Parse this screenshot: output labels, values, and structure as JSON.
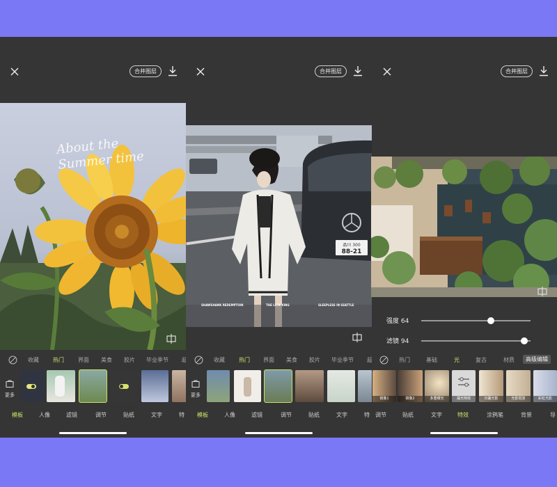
{
  "colors": {
    "accent": "#c9e36a",
    "background": "#7b78f6",
    "app_bg": "#353535"
  },
  "toolbar": {
    "merge_label": "合并图层"
  },
  "panels": [
    {
      "photo_caption": "About the Summer time",
      "categories": [
        "收藏",
        "热门",
        "界面",
        "美食",
        "胶片",
        "毕业季节",
        "超"
      ],
      "active_category": "热门",
      "more_label": "更多",
      "tabs": [
        "模板",
        "人像",
        "滤镜",
        "调节",
        "贴纸",
        "文字",
        "特"
      ],
      "active_tab": "模板"
    },
    {
      "photo_captions": [
        "SHAWSHANK REDEMPTION",
        "THE LION KING",
        "SLEEPLESS IN SEATTLE"
      ],
      "license_plate": "品川 300\n88-21",
      "categories": [
        "收藏",
        "热门",
        "界面",
        "美食",
        "胶片",
        "毕业季节",
        "超"
      ],
      "active_category": "热门",
      "more_label": "更多",
      "tabs": [
        "模板",
        "人像",
        "滤镜",
        "调节",
        "贴纸",
        "文字",
        "特"
      ],
      "active_tab": "模板"
    },
    {
      "sliders": [
        {
          "label": "强度 64",
          "value": 64
        },
        {
          "label": "滤镜 94",
          "value": 94
        }
      ],
      "categories": [
        "热门",
        "基础",
        "光",
        "复古",
        "材质",
        "高级编辑"
      ],
      "active_category": "光",
      "thumb_captions": [
        "镜像1",
        "镜像2",
        "多重曝光",
        "漏光特效",
        "日暮光影",
        "光影斑驳",
        "彩虹光影"
      ],
      "tabs": [
        "调节",
        "贴纸",
        "文字",
        "特效",
        "涂鸦笔",
        "背景",
        "导"
      ],
      "active_tab": "特效"
    }
  ]
}
